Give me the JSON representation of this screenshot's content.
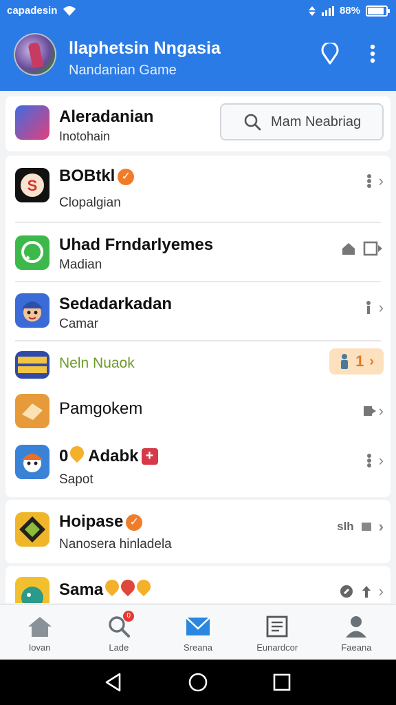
{
  "status_bar": {
    "left_text": "capadesin",
    "battery": "88%",
    "battery_level": 0.88
  },
  "header": {
    "title": "llaphetsin Nngasia",
    "subtitle": "Nandanian Game",
    "icons": {
      "location": "location-pin-icon",
      "menu": "more-vertical-icon"
    }
  },
  "category": {
    "title": "Aleradanian",
    "subtitle": "Inotohain"
  },
  "search": {
    "placeholder": "Mam Neabriag"
  },
  "apps": [
    {
      "title": "BOBtkl",
      "subtitle": "Clopalgian",
      "badge": "verified",
      "actions": [
        "more-icon",
        "chevron-right-icon"
      ]
    },
    {
      "title": "Uhad Frndarlyemes",
      "subtitle": "Madian",
      "actions": [
        "home-icon",
        "open-window-icon"
      ]
    },
    {
      "title": "Sedadarkadan",
      "subtitle": "Camar",
      "actions": [
        "more-icon",
        "chevron-right-icon"
      ]
    },
    {
      "title": "Neln Nuaok",
      "subtitle": "",
      "highlight": true,
      "pill_value": "1",
      "actions": [
        "person-icon",
        "chevron-right-icon"
      ]
    },
    {
      "title": "Pamgokem",
      "subtitle": "",
      "actions": [
        "share-icon",
        "chevron-right-icon"
      ]
    },
    {
      "title": "Adabk",
      "prefix": "0",
      "subtitle": "Sapot",
      "badge": "plus",
      "actions": [
        "more-icon",
        "chevron-right-icon"
      ]
    },
    {
      "title": "Hoipase",
      "subtitle": "Nanosera hinladela",
      "badge": "verified",
      "action_text": "slh",
      "actions": [
        "square-icon",
        "chevron-right-icon"
      ]
    },
    {
      "title": "Sama",
      "subtitle": "",
      "badge": "hearts",
      "actions": [
        "compass-icon",
        "upload-icon",
        "chevron-right-icon"
      ]
    }
  ],
  "bottom_nav": [
    {
      "label": "Iovan",
      "icon": "home-icon"
    },
    {
      "label": "Lade",
      "icon": "search-icon",
      "badge": "0"
    },
    {
      "label": "Sreana",
      "icon": "mail-icon"
    },
    {
      "label": "Eunardcor",
      "icon": "document-icon"
    },
    {
      "label": "Faeana",
      "icon": "person-icon"
    }
  ],
  "system_nav": [
    "back-icon",
    "home-circle-icon",
    "recents-icon"
  ],
  "colors": {
    "header_bg": "#2b7be6",
    "verified_badge": "#f07c2a",
    "plus_badge": "#d63a48",
    "highlight_pill": "#fde0bd",
    "highlight_text": "#e07a24",
    "green_title": "#6f9a2a"
  }
}
